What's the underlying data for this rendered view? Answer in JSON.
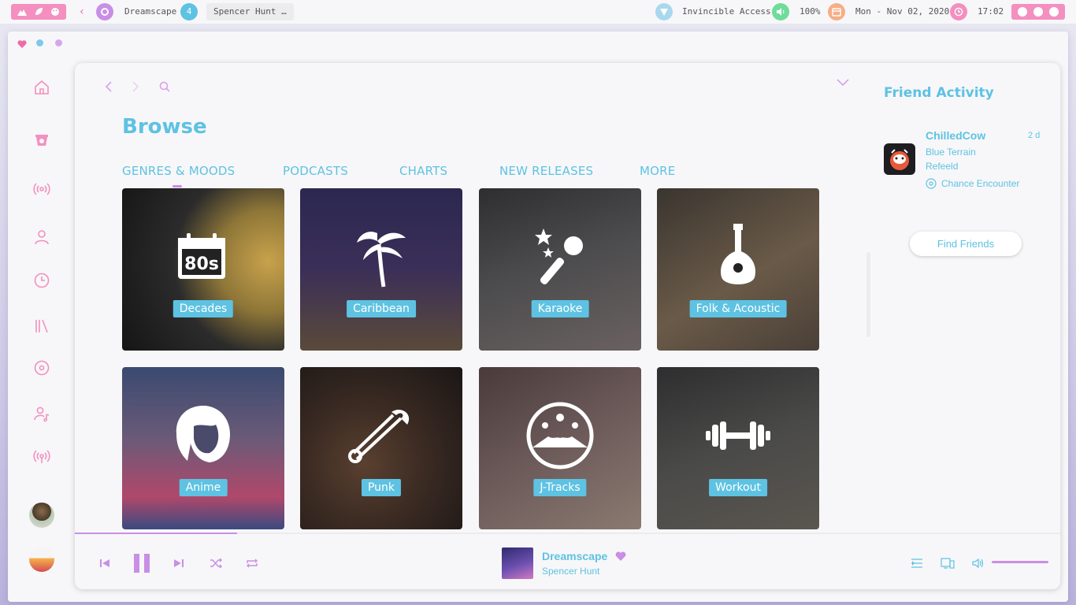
{
  "topbar": {
    "player_title": "Dreamscape",
    "workspace_number": "4",
    "artist": "Spencer Hunt …",
    "vpn": "Invincible Access",
    "volume": "100%",
    "date": "Mon - Nov 02, 2020",
    "time": "17:02"
  },
  "browse": {
    "title": "Browse",
    "tabs": [
      "GENRES & MOODS",
      "PODCASTS",
      "CHARTS",
      "NEW RELEASES",
      "MORE"
    ],
    "tiles": [
      {
        "label": "Decades",
        "icon": "calendar-80s-icon"
      },
      {
        "label": "Caribbean",
        "icon": "palm-tree-icon"
      },
      {
        "label": "Karaoke",
        "icon": "microphone-stars-icon"
      },
      {
        "label": "Folk & Acoustic",
        "icon": "mandolin-icon"
      },
      {
        "label": "Anime",
        "icon": "anime-girl-icon"
      },
      {
        "label": "Punk",
        "icon": "safety-pin-icon"
      },
      {
        "label": "J-Tracks",
        "icon": "mount-fuji-icon"
      },
      {
        "label": "Workout",
        "icon": "dumbbell-icon"
      }
    ]
  },
  "friends": {
    "title": "Friend Activity",
    "items": [
      {
        "name": "ChilledCow",
        "time": "2 d",
        "track": "Blue Terrain",
        "artist": "Refeeld",
        "context": "Chance Encounter"
      }
    ],
    "find_button": "Find Friends"
  },
  "player": {
    "track": "Dreamscape",
    "artist": "Spencer Hunt",
    "progress": 0.165,
    "volume": 1.0
  },
  "colors": {
    "accent_blue": "#5ec2e2",
    "accent_purple": "#c98ee6",
    "accent_pink": "#f48fc0"
  }
}
